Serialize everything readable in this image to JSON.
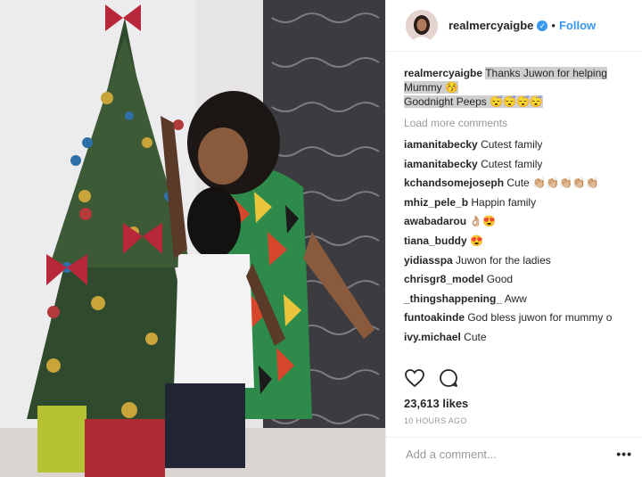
{
  "header": {
    "username": "realmercyaigbe",
    "verified_icon": "verified-badge-icon",
    "separator": "•",
    "follow_label": "Follow"
  },
  "caption": {
    "username": "realmercyaigbe",
    "line1": "Thanks Juwon for helping Mummy 😚",
    "line2": "Goodnight Peeps 😴😴😴😴"
  },
  "load_more_label": "Load more comments",
  "comments": [
    {
      "user": "iamanitabecky",
      "text": "Cutest family"
    },
    {
      "user": "iamanitabecky",
      "text": "Cutest family"
    },
    {
      "user": "kchandsomejoseph",
      "text": "Cute 👏🏼👏🏼👏🏼👏🏼👏🏼"
    },
    {
      "user": "mhiz_pele_b",
      "text": "Happin family"
    },
    {
      "user": "awabadarou",
      "text": "👌🏼😍"
    },
    {
      "user": "tiana_buddy",
      "text": "😍"
    },
    {
      "user": "yidiasspa",
      "text": "Juwon for the ladies"
    },
    {
      "user": "chrisgr8_model",
      "text": "Good"
    },
    {
      "user": "_thingshappening_",
      "text": "Aww"
    },
    {
      "user": "funtoakinde",
      "text": "God bless juwon for mummy o"
    },
    {
      "user": "ivy.michael",
      "text": "Cute"
    }
  ],
  "actions": {
    "like_icon": "heart-icon",
    "comment_icon": "comment-icon"
  },
  "likes": "23,613 likes",
  "timestamp": "10 HOURS AGO",
  "add_comment": {
    "placeholder": "Add a comment...",
    "more_label": "•••"
  },
  "colors": {
    "link": "#3897f0",
    "text": "#262626",
    "muted": "#999999",
    "highlight": "#cfcfcf"
  }
}
